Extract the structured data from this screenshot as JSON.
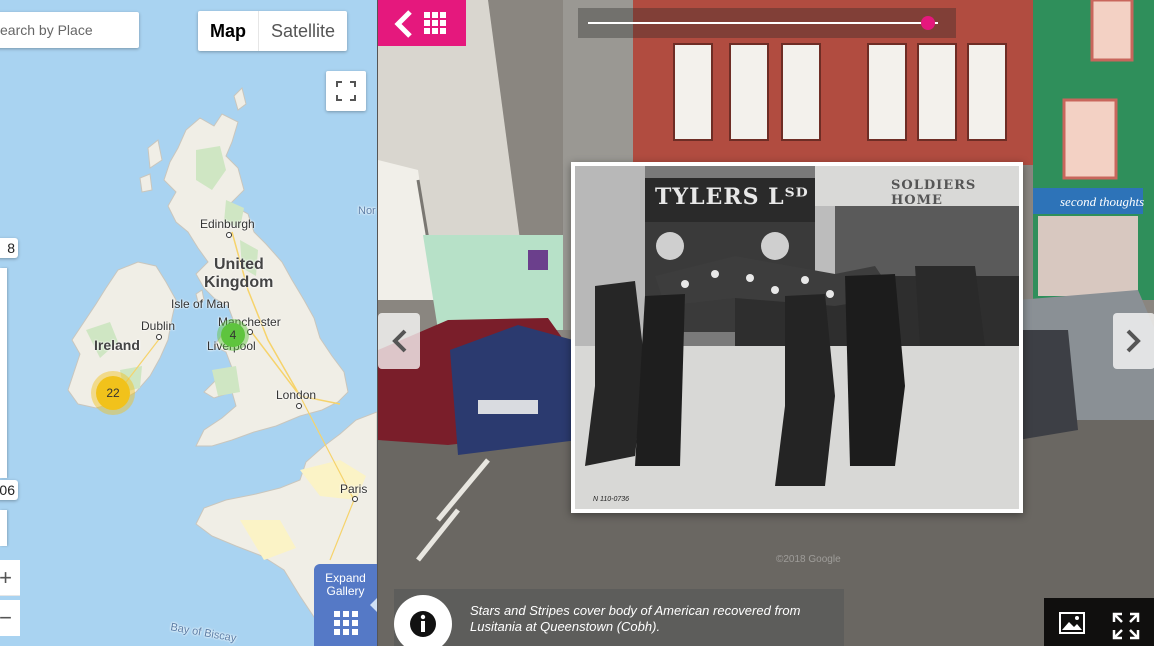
{
  "map": {
    "search_placeholder": "Search by Place",
    "search_visible_text": "earch by Place",
    "map_type": {
      "map_label": "Map",
      "satellite_label": "Satellite",
      "selected": "Map"
    },
    "places": {
      "edinburgh": "Edinburgh",
      "united_kingdom_line1": "United",
      "united_kingdom_line2": "Kingdom",
      "isle_of_man": "Isle of Man",
      "dublin": "Dublin",
      "ireland": "Ireland",
      "manchester": "Manchester",
      "liverpool": "Liverpool",
      "london": "London",
      "paris": "Paris",
      "bay_of_biscay": "Bay of Biscay",
      "north_sea_fragment": "Nor"
    },
    "clusters": {
      "ireland_south": "22",
      "liverpool": "4"
    },
    "year_slider": {
      "top_value": "8",
      "bottom_value": "06"
    },
    "zoom": {
      "in": "+",
      "out": "−"
    },
    "expand_gallery_line1": "Expand",
    "expand_gallery_line2": "Gallery",
    "colors": {
      "water": "#a9d3f1",
      "land": "#f0eee6",
      "cluster_yellow": "#f1c21b",
      "cluster_green": "#5ec43e",
      "gallery_blue": "#5579c6"
    }
  },
  "viewer": {
    "accent": "#e5187d",
    "icons": {
      "back": "chevron-left-icon",
      "grid": "grid-icon",
      "info": "info-icon",
      "image": "image-icon",
      "fullscreen": "fullscreen-icon"
    },
    "timeline_position": 0.97,
    "photo": {
      "sign_left": "TYLERS Lᵀᴰ",
      "sign_right": "SOLDIERS HOME",
      "negative_number": "N 110-0736"
    },
    "storefront_sign": "second thoughts",
    "caption": "Stars and Stripes cover body of American recovered from Lusitania at Queenstown (Cobh).",
    "watermark": "©2018 Google"
  }
}
